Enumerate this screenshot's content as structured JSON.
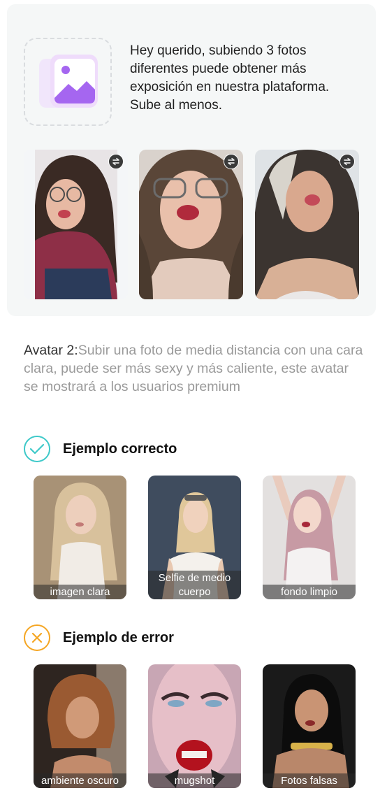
{
  "intro_text": "Hey querido, subiendo 3 fotos diferentes puede obtener más exposición en nuestra plataforma. Sube al menos.",
  "uploaded_photos": [
    {
      "icon": "swap-icon"
    },
    {
      "icon": "swap-icon"
    },
    {
      "icon": "swap-icon"
    }
  ],
  "avatar": {
    "lead": "Avatar 2:",
    "description": "Subir una foto de media distancia con una cara clara, puede ser más sexy y más caliente, este avatar se mostrará a los usuarios premium"
  },
  "correct_section": {
    "title": "Ejemplo correcto",
    "color": "#3ec9c9",
    "examples": [
      "imagen clara",
      "Selfie de medio cuerpo",
      "fondo limpio"
    ]
  },
  "error_section": {
    "title": "Ejemplo de error",
    "color": "#f5a623",
    "examples": [
      "ambiente oscuro",
      "mugshot",
      "Fotos falsas"
    ]
  }
}
